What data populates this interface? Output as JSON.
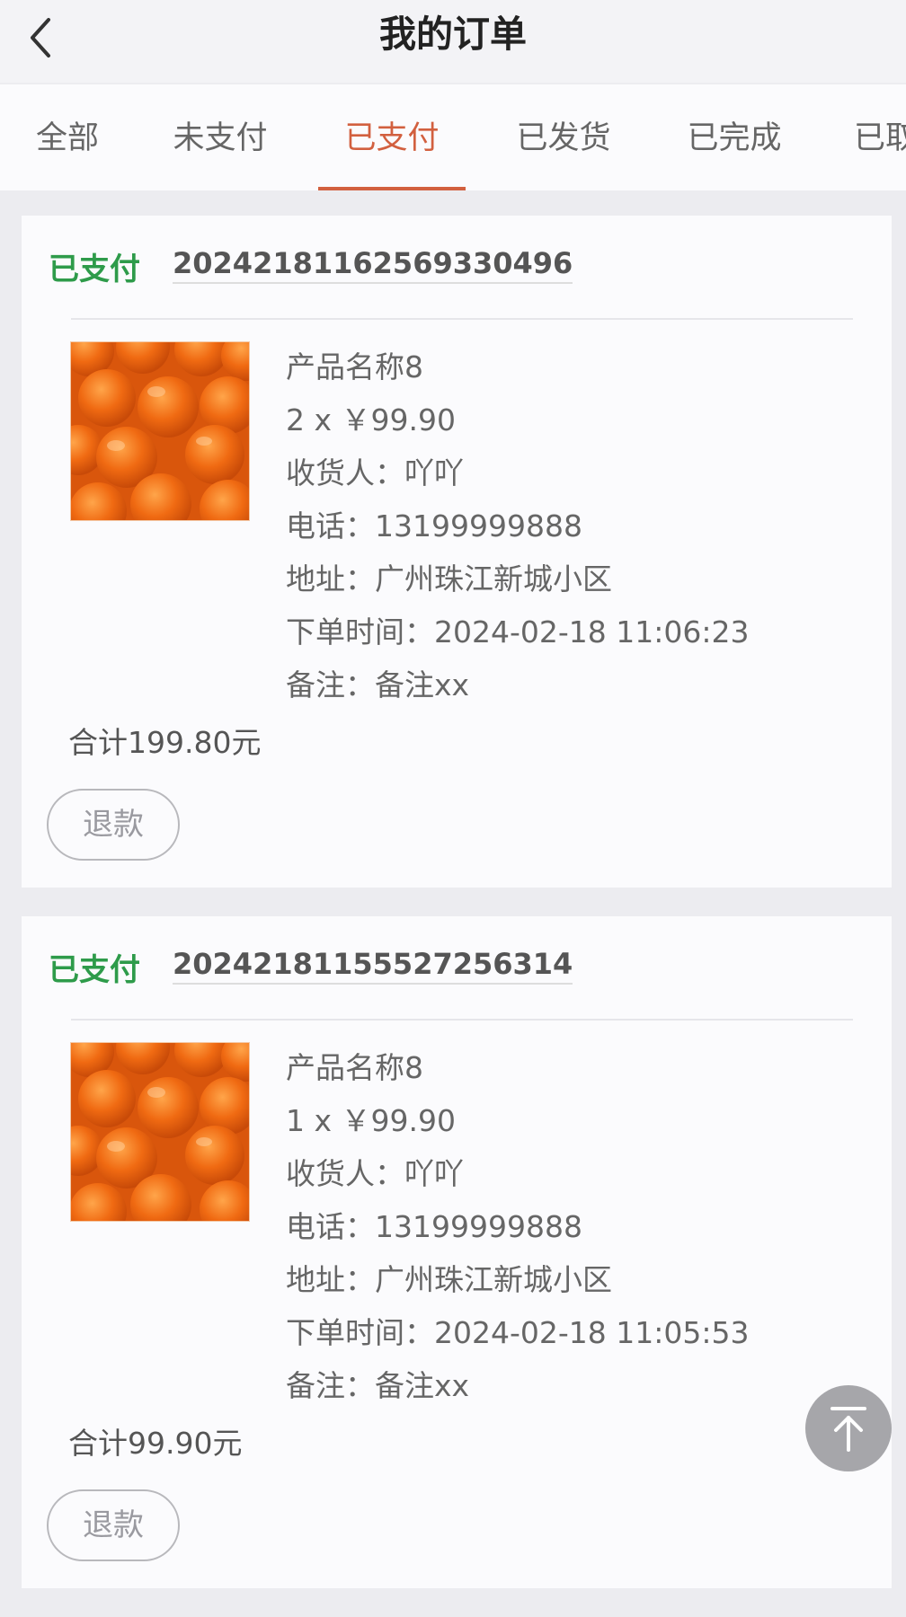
{
  "header": {
    "title": "我的订单"
  },
  "tabs": [
    {
      "label": "全部"
    },
    {
      "label": "未支付"
    },
    {
      "label": "已支付"
    },
    {
      "label": "已发货"
    },
    {
      "label": "已完成"
    },
    {
      "label": "已取消"
    }
  ],
  "active_tab_index": 2,
  "orders": [
    {
      "status": "已支付",
      "order_no": "20242181162569330496",
      "product_name": "产品名称8",
      "qty_price": "2 x ￥99.90",
      "receiver": "收货人：吖吖",
      "phone": "电话：13199999888",
      "address": "地址：广州珠江新城小区",
      "order_time": "下单时间：2024-02-18 11:06:23",
      "note": "备注：备注xx",
      "total": "合计199.80元",
      "refund_label": "退款"
    },
    {
      "status": "已支付",
      "order_no": "20242181155527256314",
      "product_name": "产品名称8",
      "qty_price": "1 x ￥99.90",
      "receiver": "收货人：吖吖",
      "phone": "电话：13199999888",
      "address": "地址：广州珠江新城小区",
      "order_time": "下单时间：2024-02-18 11:05:53",
      "note": "备注：备注xx",
      "total": "合计99.90元",
      "refund_label": "退款"
    }
  ],
  "icons": {
    "back": "chevron-left-icon",
    "product_image": "oranges-image",
    "scroll_top": "arrow-up-to-top-icon"
  },
  "colors": {
    "accent": "#d2603f",
    "status_paid": "#2e9b4a",
    "background": "#ececf0",
    "card": "#fbfbfd"
  }
}
